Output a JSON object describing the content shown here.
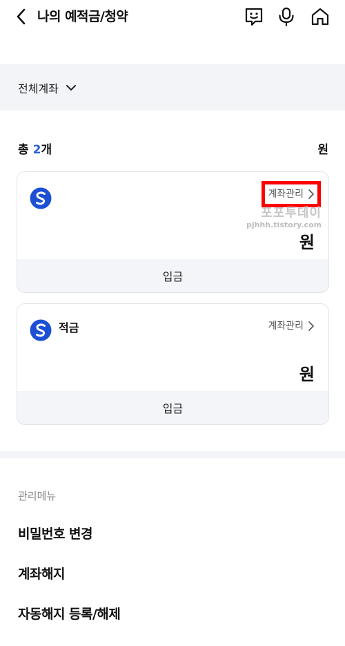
{
  "header": {
    "title": "나의 예적금/청약",
    "icons": [
      "chat-bot-icon",
      "microphone-icon",
      "home-icon"
    ]
  },
  "filter": {
    "label": "전체계좌"
  },
  "summary": {
    "prefix": "총",
    "count": "2",
    "suffix": "개",
    "total_unit": "원"
  },
  "accounts": [
    {
      "name": "",
      "manage_label": "계좌관리",
      "amount_unit": "원",
      "action_label": "입금",
      "highlighted": true
    },
    {
      "name": "적금",
      "manage_label": "계좌관리",
      "amount_unit": "원",
      "action_label": "입금",
      "highlighted": false
    }
  ],
  "watermark": {
    "main": "포포투데이",
    "sub": "pjhhh.tistory.com"
  },
  "menu": {
    "header": "관리메뉴",
    "items": [
      "비밀번호 변경",
      "계좌해지",
      "자동해지 등록/해제"
    ]
  },
  "colors": {
    "accent": "#2761d6",
    "bank_logo": "#1c4fd4",
    "highlight": "#ff0000"
  }
}
